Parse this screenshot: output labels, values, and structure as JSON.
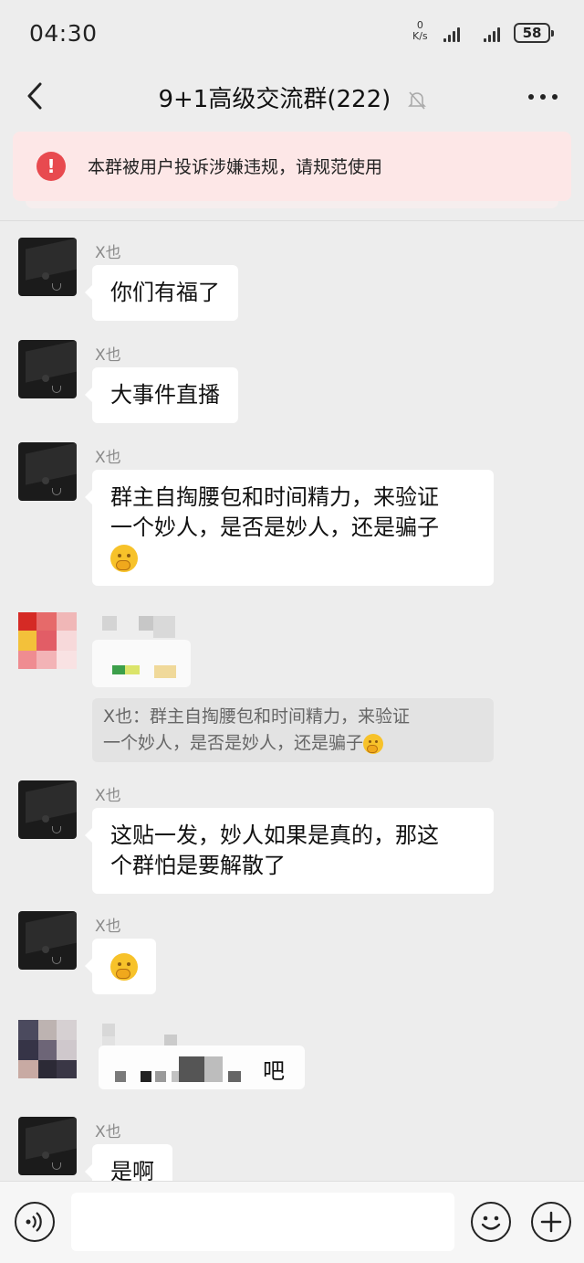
{
  "status_bar": {
    "time": "04:30",
    "net_speed_value": "0",
    "net_speed_unit": "K/s",
    "battery": "58"
  },
  "header": {
    "title": "9+1高级交流群(222)",
    "back_icon": "chevron-left-icon",
    "mute_icon": "bell-off-icon",
    "more_icon": "more-dots-icon"
  },
  "banner": {
    "icon": "exclamation-icon",
    "text": "本群被用户投诉涉嫌违规，请规范使用",
    "accent": "#e84a4f"
  },
  "messages": [
    {
      "sender": "X也",
      "text": "你们有福了"
    },
    {
      "sender": "X也",
      "text": "大事件直播"
    },
    {
      "sender": "X也",
      "lines": [
        "群主自掏腰包和时间精力，来验证",
        "一个妙人，是否是妙人，还是骗子"
      ],
      "emoji": "thinking-hand-emoji"
    },
    {
      "sender": "",
      "blurred": true,
      "quote_lines": [
        "X也：群主自掏腰包和时间精力，来验证",
        "一个妙人，是否是妙人，还是骗子"
      ]
    },
    {
      "sender": "X也",
      "lines": [
        "这贴一发，妙人如果是真的，那这",
        "个群怕是要解散了"
      ]
    },
    {
      "sender": "X也",
      "emoji": "thinking-hand-emoji"
    },
    {
      "sender": "",
      "blurred": true,
      "visible_text": "吧"
    },
    {
      "sender": "X也",
      "text": "是啊"
    }
  ],
  "input_bar": {
    "voice_icon": "voice-icon",
    "emoji_icon": "smiley-icon",
    "plus_icon": "plus-icon",
    "placeholder": ""
  }
}
